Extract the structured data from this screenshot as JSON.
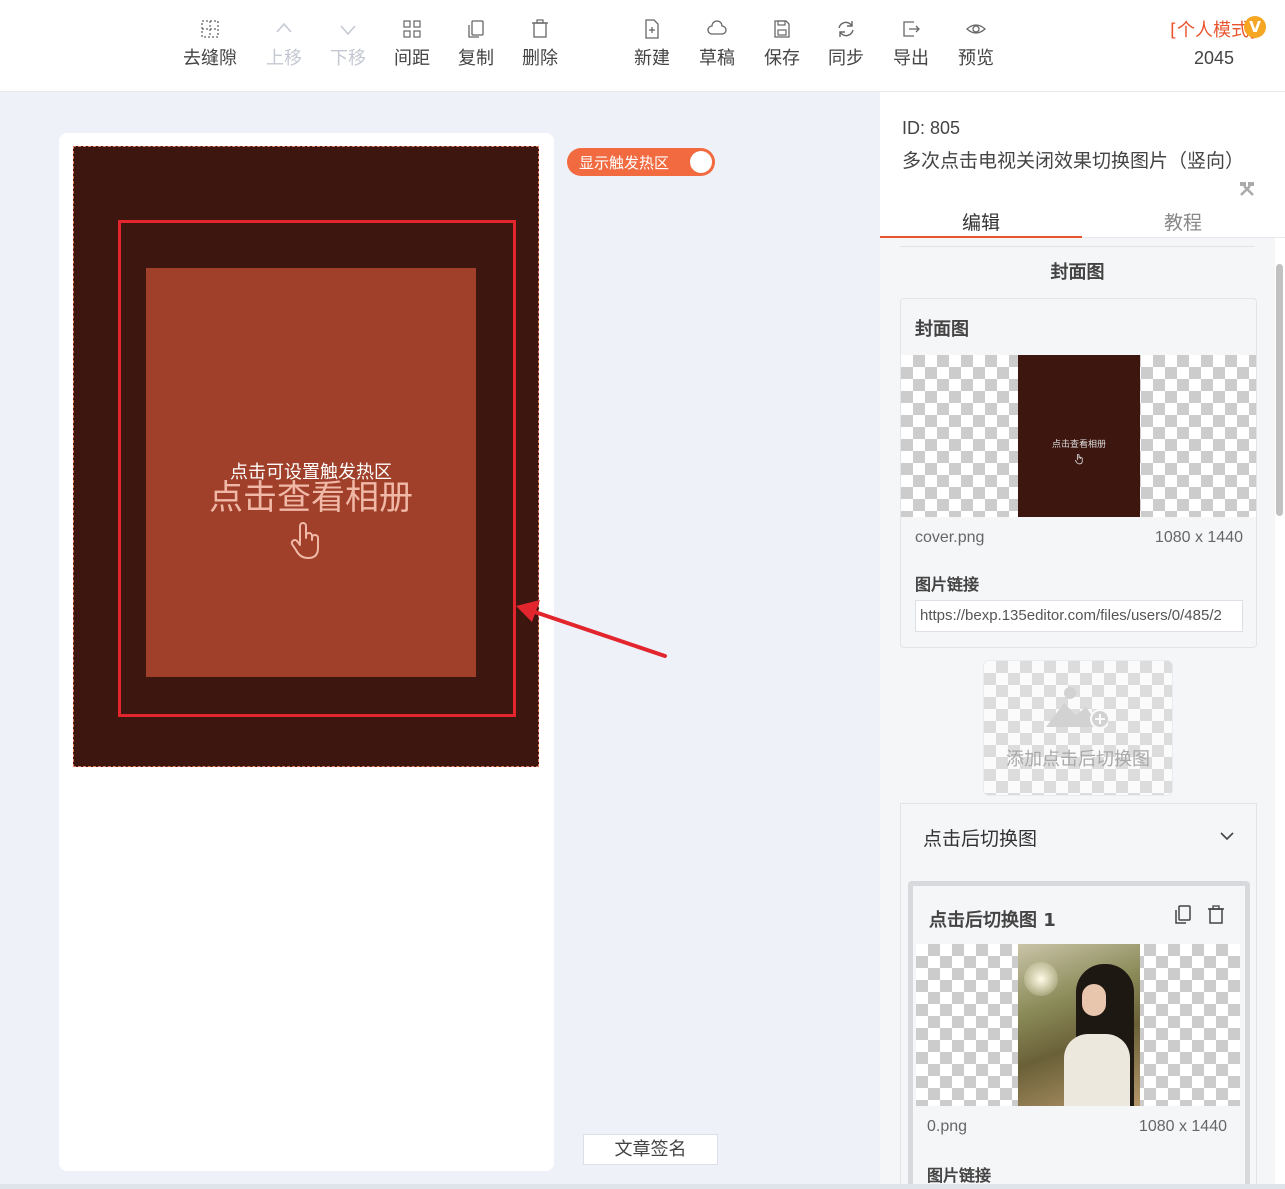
{
  "toolbar": {
    "items": [
      {
        "label": "去缝隙",
        "icon": "grid-icon",
        "enabled": true
      },
      {
        "label": "上移",
        "icon": "chevron-up-icon",
        "enabled": false
      },
      {
        "label": "下移",
        "icon": "chevron-down-icon",
        "enabled": false
      },
      {
        "label": "间距",
        "icon": "spacing-icon",
        "enabled": true
      },
      {
        "label": "复制",
        "icon": "copy-icon",
        "enabled": true
      },
      {
        "label": "删除",
        "icon": "trash-icon",
        "enabled": true
      },
      {
        "label": "新建",
        "icon": "new-file-icon",
        "enabled": true
      },
      {
        "label": "草稿",
        "icon": "cloud-icon",
        "enabled": true
      },
      {
        "label": "保存",
        "icon": "save-icon",
        "enabled": true
      },
      {
        "label": "同步",
        "icon": "sync-icon",
        "enabled": true
      },
      {
        "label": "导出",
        "icon": "export-icon",
        "enabled": true
      },
      {
        "label": "预览",
        "icon": "eye-icon",
        "enabled": true
      }
    ],
    "mode_label": "[个人模式]",
    "mode_badge": "V",
    "mode_number": "2045"
  },
  "canvas": {
    "hotzone_label": "点击可设置触发热区",
    "album_text": "点击查看相册",
    "toggle_label": "显示触发热区",
    "toggle_on": true,
    "signature_button": "文章签名",
    "colors": {
      "poster_bg": "#3d1610",
      "inner_bg": "#a0402a",
      "frame": "#e3262e",
      "accent": "#f26a40"
    }
  },
  "panel": {
    "id_text": "ID: 805",
    "name": "多次点击电视关闭效果切换图片（竖向）",
    "tabs": [
      {
        "label": "编辑",
        "active": true
      },
      {
        "label": "教程",
        "active": false
      }
    ],
    "section_title": "封面图",
    "cover": {
      "title": "封面图",
      "thumb_text": "点击查看相册",
      "file_name": "cover.png",
      "file_size": "1080 x 1440",
      "link_label": "图片链接",
      "link_value": "https://bexp.135editor.com/files/users/0/485/2"
    },
    "add_switch_label": "添加点击后切换图",
    "switch_section": {
      "title": "点击后切换图",
      "item": {
        "title": "点击后切换图 1",
        "file_name": "0.png",
        "file_size": "1080 x 1440",
        "link_label": "图片链接"
      }
    }
  }
}
